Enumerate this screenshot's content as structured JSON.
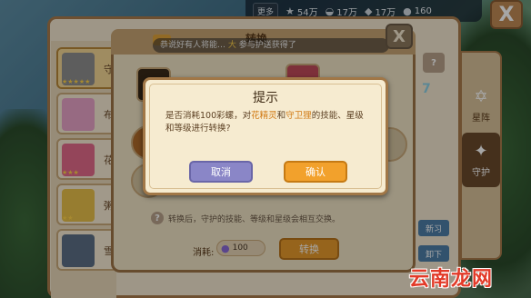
{
  "topbar": {
    "more_label": "更多",
    "stats": [
      {
        "icon": "star-icon",
        "glyph": "★",
        "value": "54万"
      },
      {
        "icon": "shell-icon",
        "glyph": "◒",
        "value": "17万"
      },
      {
        "icon": "gem-icon",
        "glyph": "◆",
        "value": "17万"
      },
      {
        "icon": "orb-icon",
        "glyph": "●",
        "value": "160"
      }
    ]
  },
  "close_glyph": "X",
  "character_list": [
    {
      "name": "守",
      "avatar_color": "#8f8f8f",
      "stars": "★★★★★"
    },
    {
      "name": "布",
      "avatar_color": "#e8a4c8",
      "stars": ""
    },
    {
      "name": "花",
      "avatar_color": "#e46a8a",
      "stars": "★★★"
    },
    {
      "name": "粥",
      "avatar_color": "#e9c04a",
      "stars": "★★"
    },
    {
      "name": "雪",
      "avatar_color": "#5d6f86",
      "stars": ""
    }
  ],
  "tabs": [
    {
      "glyph": "✡",
      "label": "星阵"
    },
    {
      "glyph": "✦",
      "label": "守护"
    }
  ],
  "transfer": {
    "title": "转换",
    "ticker_text": "恭说好有人将能",
    "ticker_highlight": "大",
    "ticker_tail": "参与护送获得了",
    "help_glyph": "?",
    "description": "转换后，守护的技能、等级和星级会相互交换。",
    "cost_label": "消耗:",
    "cost_value": "100",
    "button_label": "转换",
    "side_number": "7",
    "side_button_1": "新习",
    "side_button_2": "卸下"
  },
  "modal": {
    "title": "提示",
    "msg_part1": "是否消耗100彩螺，对",
    "msg_hl1": "花精灵",
    "msg_part2": "和",
    "msg_hl2": "守卫狸",
    "msg_part3": "的技能、星级和等级进行转换?",
    "cancel_label": "取消",
    "ok_label": "确认"
  },
  "watermark": "云南龙网"
}
